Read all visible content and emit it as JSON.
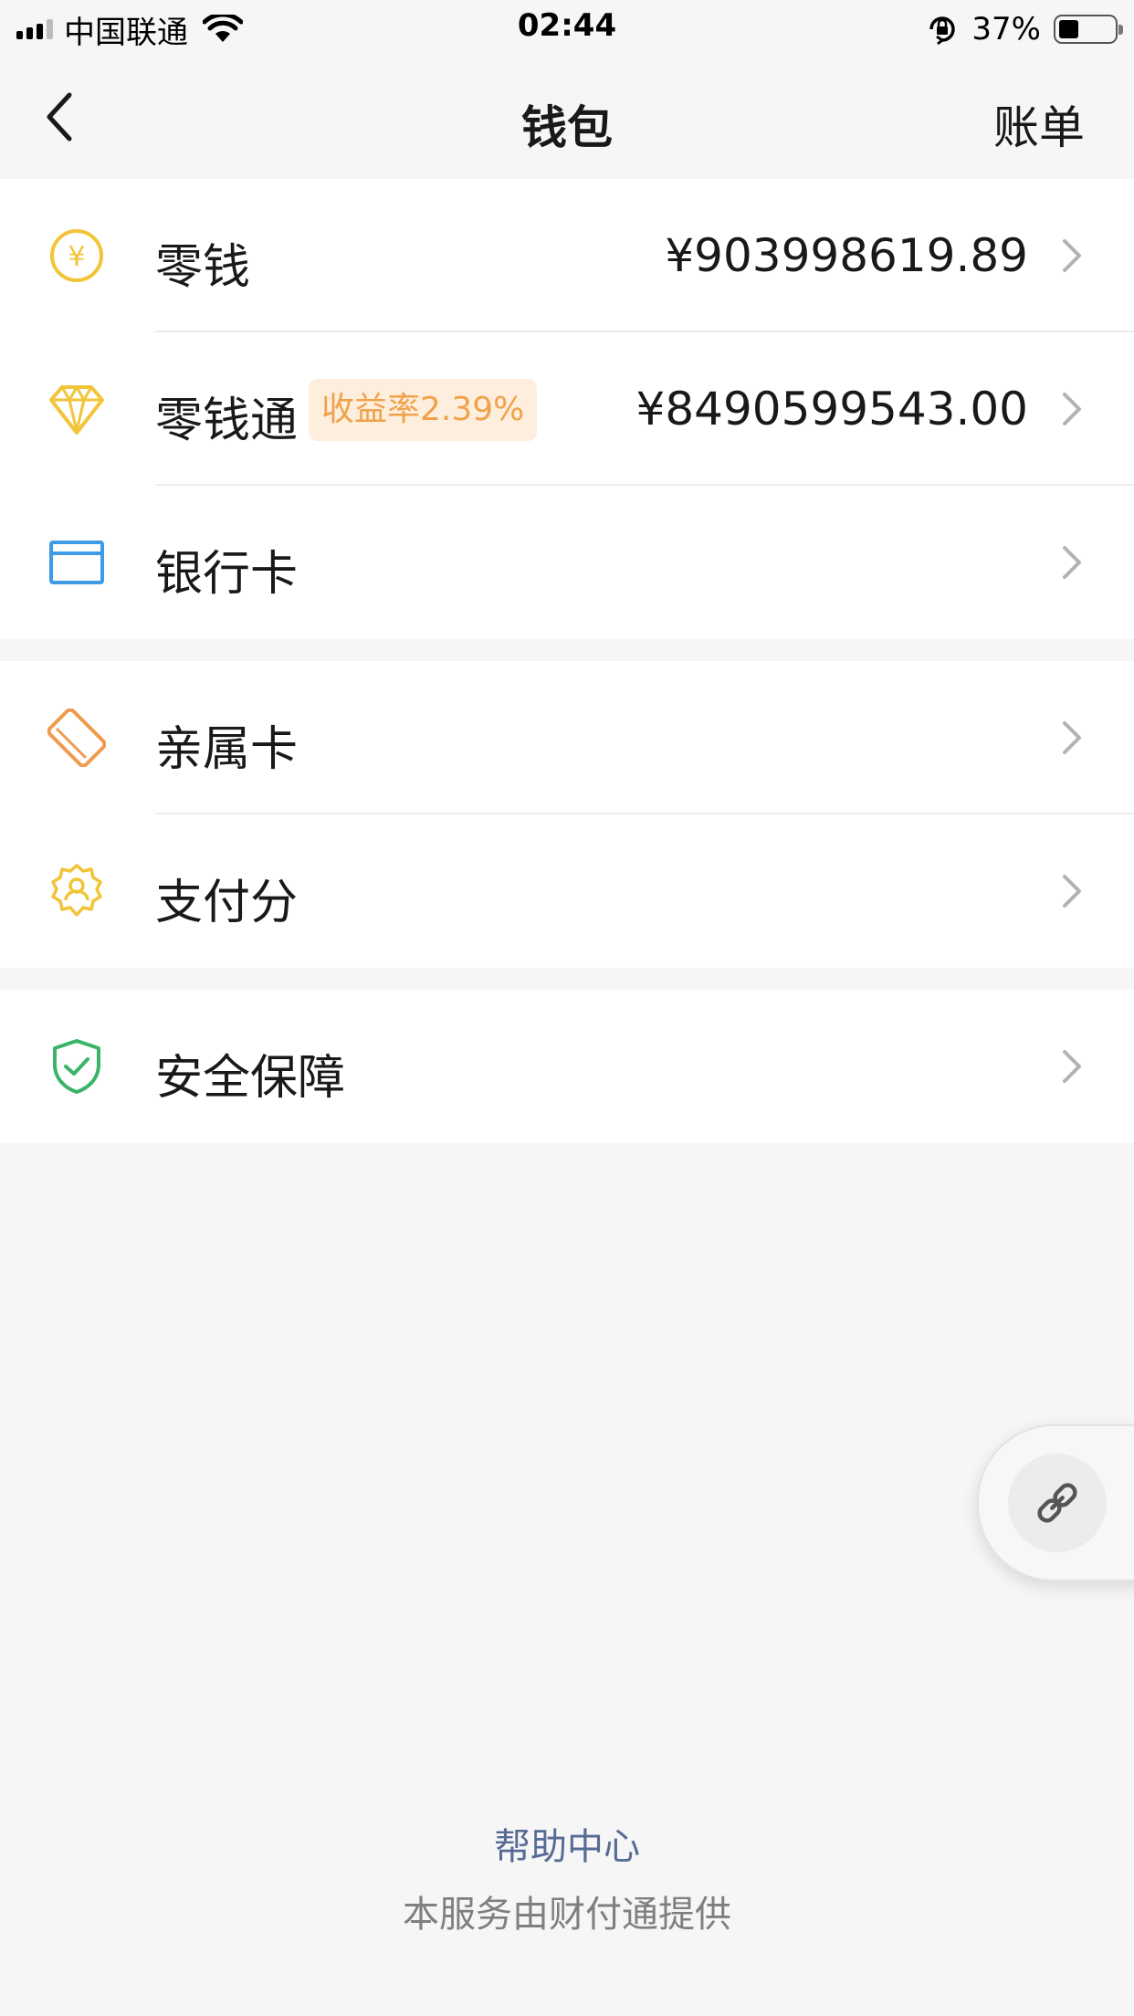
{
  "status_bar": {
    "carrier": "中国联通",
    "time": "02:44",
    "battery_percent": "37%",
    "battery_level": 0.37
  },
  "nav": {
    "title": "钱包",
    "right_action": "账单"
  },
  "groups": [
    {
      "items": [
        {
          "label": "零钱",
          "value": "¥903998619.89",
          "icon": "yuan-coin-icon",
          "color": "#f2c438"
        },
        {
          "label": "零钱通",
          "badge": "收益率2.39%",
          "value": "¥8490599543.00",
          "icon": "diamond-icon",
          "color": "#f2c438"
        },
        {
          "label": "银行卡",
          "icon": "bank-card-icon",
          "color": "#3f9be6"
        }
      ]
    },
    {
      "items": [
        {
          "label": "亲属卡",
          "icon": "family-card-icon",
          "color": "#ef9a4c"
        },
        {
          "label": "支付分",
          "icon": "pay-score-icon",
          "color": "#f2c438"
        }
      ]
    },
    {
      "items": [
        {
          "label": "安全保障",
          "icon": "shield-check-icon",
          "color": "#3bb46a"
        }
      ]
    }
  ],
  "floating_button": {
    "icon": "link-icon"
  },
  "footer": {
    "help": "帮助中心",
    "provider": "本服务由财付通提供"
  },
  "colors": {
    "background": "#f6f6f6",
    "link": "#576b95",
    "badge_bg": "#fdeedd",
    "badge_text": "#f0a24a"
  }
}
